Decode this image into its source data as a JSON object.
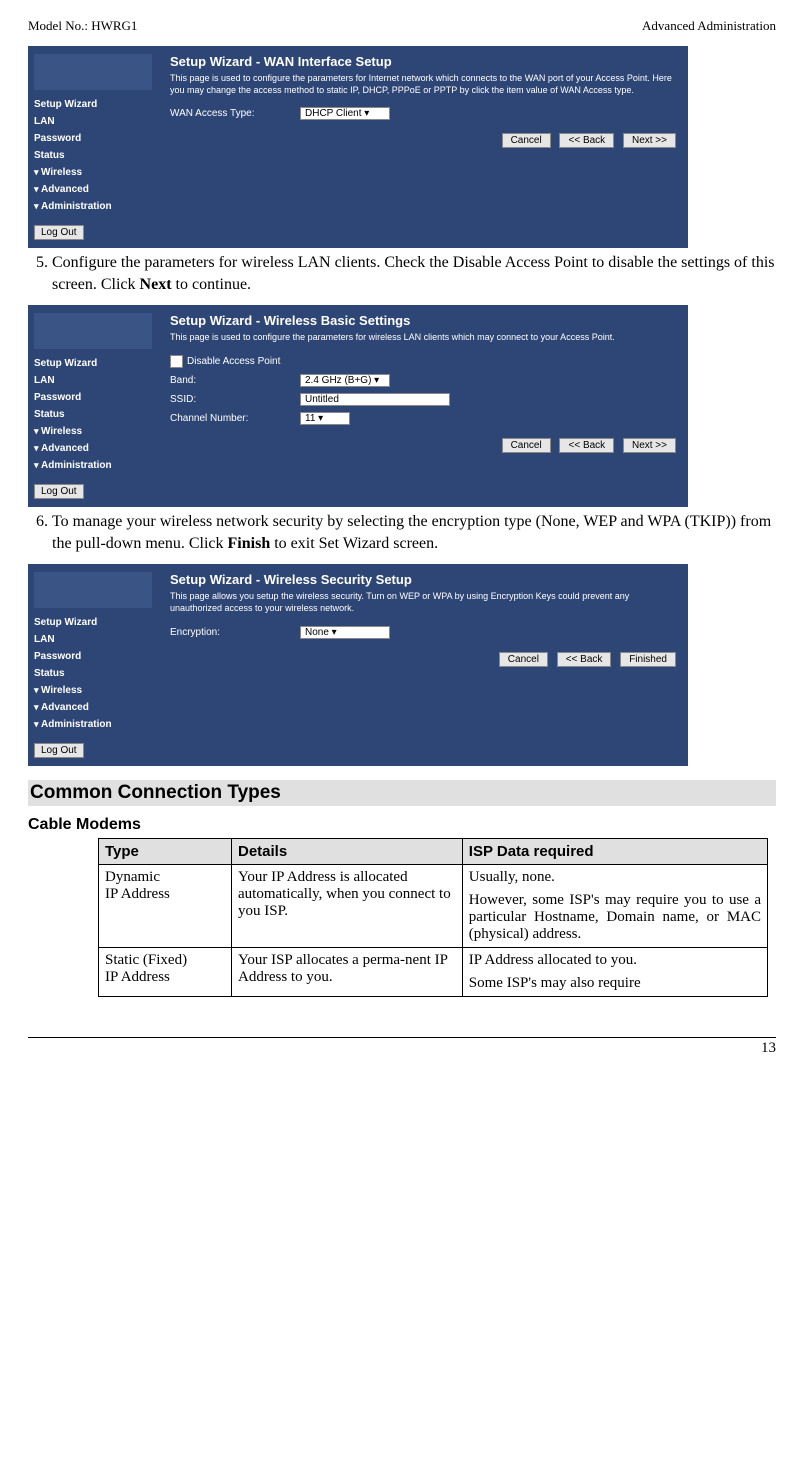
{
  "header": {
    "left": "Model No.: HWRG1",
    "right": "Advanced Administration"
  },
  "shot_common": {
    "menu": [
      "Setup Wizard",
      "LAN",
      "Password",
      "Status"
    ],
    "collapsibles": [
      "Wireless",
      "Advanced",
      "Administration"
    ],
    "logout": "Log Out"
  },
  "shot1": {
    "title": "Setup Wizard - WAN Interface Setup",
    "desc": "This page is used to configure the parameters for Internet network which connects to the WAN port of your Access Point. Here you may change the access method to static IP, DHCP, PPPoE or PPTP by click the item value of WAN Access type.",
    "row1_label": "WAN Access Type:",
    "row1_value": "DHCP Client ▾",
    "btns": [
      "Cancel",
      "<< Back",
      "Next >>"
    ]
  },
  "step5": "Configure the parameters for wireless LAN clients. Check the Disable Access Point to disable the settings of this screen. Click ",
  "step5_bold": "Next",
  "step5_tail": " to continue.",
  "shot2": {
    "title": "Setup Wizard - Wireless Basic Settings",
    "desc": "This page is used to configure the parameters for wireless LAN clients which may connect to your Access Point.",
    "chk_label": "Disable Access Point",
    "row_band_lbl": "Band:",
    "row_band_val": "2.4 GHz (B+G) ▾",
    "row_ssid_lbl": "SSID:",
    "row_ssid_val": "Untitled",
    "row_ch_lbl": "Channel Number:",
    "row_ch_val": "11  ▾",
    "btns": [
      "Cancel",
      "<< Back",
      "Next >>"
    ]
  },
  "step6": "To manage your wireless network security by selecting the encryption type (None, WEP and WPA (TKIP)) from the pull-down menu. Click ",
  "step6_bold": "Finish",
  "step6_tail": " to exit Set Wizard screen.",
  "shot3": {
    "title": "Setup Wizard - Wireless Security Setup",
    "desc": "This page allows you setup the wireless security. Turn on WEP or WPA by using Encryption Keys could prevent any unauthorized access to your wireless network.",
    "row_enc_lbl": "Encryption:",
    "row_enc_val": "None     ▾",
    "btns": [
      "Cancel",
      "<< Back",
      "Finished"
    ]
  },
  "section_title": "Common Connection Types",
  "sub_title": "Cable Modems",
  "table": {
    "headers": [
      "Type",
      "Details",
      "ISP Data required"
    ],
    "rows": [
      {
        "c1": "Dynamic\nIP Address",
        "c2": "Your IP Address is allocated automatically, when you connect to you ISP.",
        "c3a": "Usually, none.",
        "c3b": "However, some ISP's may require you to use a particular Hostname, Domain name, or MAC (physical) address."
      },
      {
        "c1": "Static (Fixed)\nIP Address",
        "c2": "Your ISP allocates a perma-nent IP Address to you.",
        "c3a": "IP Address allocated to you.",
        "c3b": "Some ISP's may also require"
      }
    ]
  },
  "page_number": "13"
}
